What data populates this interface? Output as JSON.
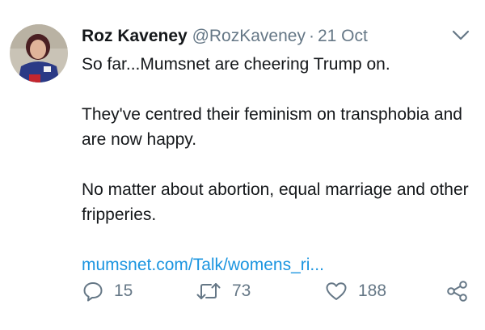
{
  "tweet": {
    "author": {
      "display_name": "Roz Kaveney",
      "handle": "@RozKaveney"
    },
    "separator": "·",
    "timestamp": "21 Oct",
    "paragraphs": [
      "So far...Mumsnet are cheering Trump on.",
      "They've centred their feminism on transphobia and are now happy.",
      "No matter about abortion, equal marriage and other fripperies."
    ],
    "link_text": "mumsnet.com/Talk/womens_ri...",
    "actions": {
      "reply_count": "15",
      "retweet_count": "73",
      "like_count": "188"
    }
  },
  "colors": {
    "text": "#14171a",
    "secondary": "#657786",
    "link": "#1b95e0"
  },
  "icons": [
    "chevron-down-icon",
    "reply-icon",
    "retweet-icon",
    "like-icon",
    "share-icon"
  ]
}
